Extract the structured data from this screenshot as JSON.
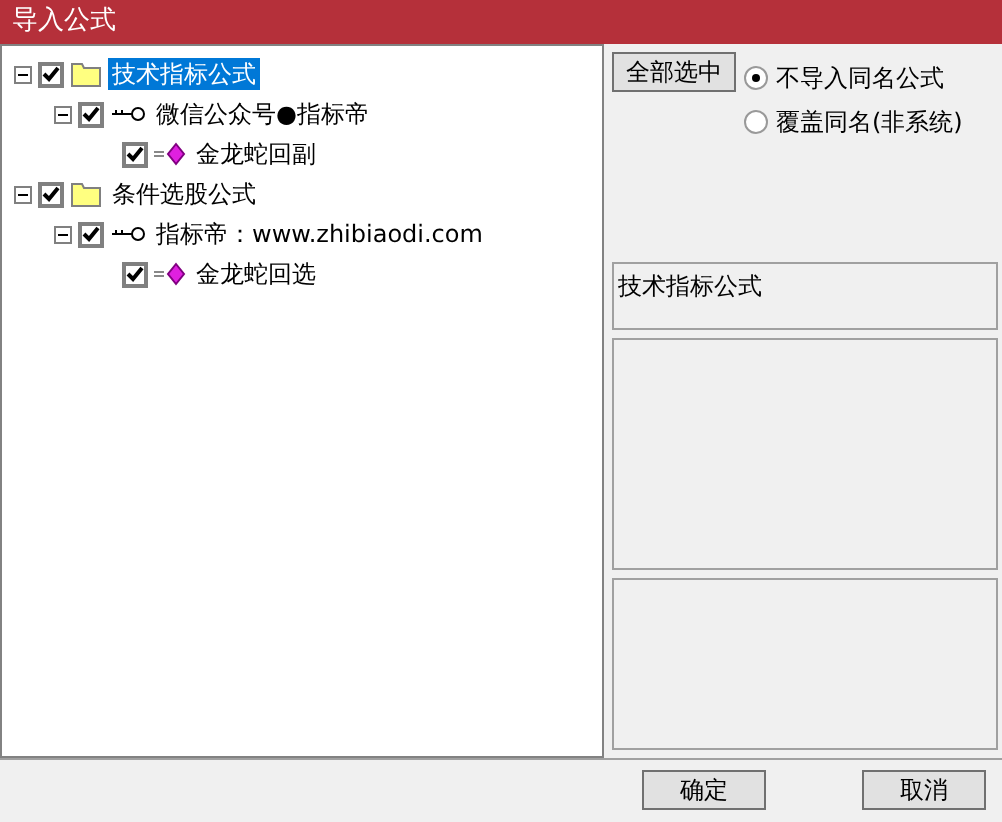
{
  "window": {
    "title": "导入公式"
  },
  "tree": [
    {
      "label": "技术指标公式",
      "kind": "folder",
      "checked": true,
      "selected": true,
      "expanded": true,
      "children": [
        {
          "label": "微信公众号●指标帝",
          "kind": "key",
          "checked": true,
          "selected": false,
          "expanded": true,
          "children": [
            {
              "label": "金龙蛇回副",
              "kind": "formula",
              "checked": true,
              "selected": false
            }
          ]
        }
      ]
    },
    {
      "label": "条件选股公式",
      "kind": "folder",
      "checked": true,
      "selected": false,
      "expanded": true,
      "children": [
        {
          "label": "指标帝：www.zhibiaodi.com",
          "kind": "key",
          "checked": true,
          "selected": false,
          "expanded": true,
          "children": [
            {
              "label": "金龙蛇回选",
              "kind": "formula",
              "checked": true,
              "selected": false
            }
          ]
        }
      ]
    }
  ],
  "select_all_button": "全部选中",
  "options": [
    {
      "label": "不导入同名公式",
      "selected": true
    },
    {
      "label": "覆盖同名(非系统)",
      "selected": false
    }
  ],
  "info_panel": "技术指标公式",
  "buttons": [
    "确定",
    "取消"
  ]
}
